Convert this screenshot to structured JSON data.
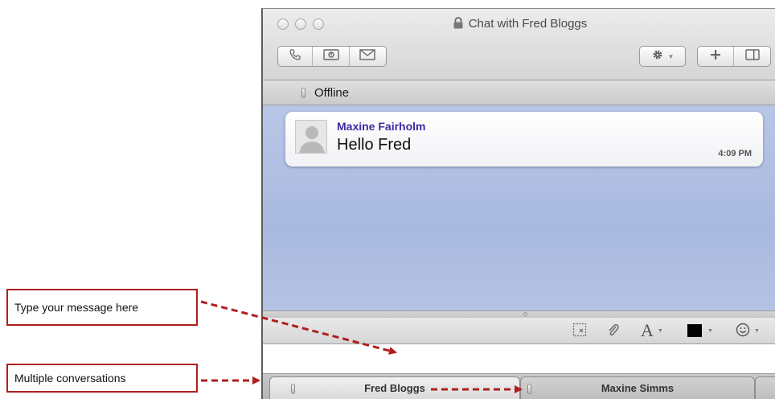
{
  "window": {
    "title": "Chat with Fred Bloggs",
    "status": "Offline",
    "toolbar_left": [
      {
        "icon": "phone-icon"
      },
      {
        "icon": "screen-share-icon"
      },
      {
        "icon": "envelope-icon"
      }
    ],
    "toolbar_right": [
      {
        "icon": "gear-icon"
      },
      {
        "icon": "add-icon"
      },
      {
        "icon": "panel-toggle-icon"
      }
    ]
  },
  "message": {
    "sender": "Maxine Fairholm",
    "text": "Hello Fred",
    "time": "4:09 PM"
  },
  "format_bar": {
    "font_label": "A",
    "text_color": "#000000"
  },
  "tabs": [
    {
      "label": "Fred Bloggs",
      "active": true
    },
    {
      "label": "Maxine Simms",
      "active": false
    }
  ],
  "callouts": {
    "type_message": "Type your message here",
    "multiple_conversations": "Multiple conversations"
  },
  "colors": {
    "callout_border": "#b01e1e",
    "sender_name": "#3a2ca0",
    "chat_background": "#b8c6e6"
  }
}
